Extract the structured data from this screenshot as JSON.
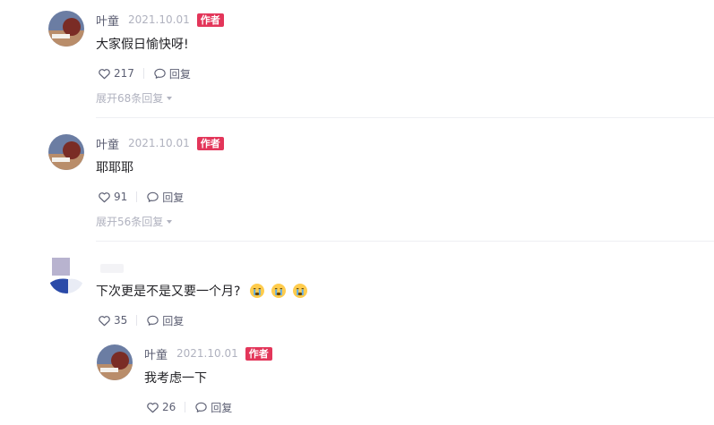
{
  "comments": [
    {
      "author": "叶童",
      "date": "2021.10.01",
      "badge": "作者",
      "text": "大家假日愉快呀!",
      "likes": "217",
      "reply_label": "回复",
      "expand_label": "展开68条回复"
    },
    {
      "author": "叶童",
      "date": "2021.10.01",
      "badge": "作者",
      "text": "耶耶耶",
      "likes": "91",
      "reply_label": "回复",
      "expand_label": "展开56条回复"
    },
    {
      "text": "下次更是不是又要一个月?",
      "likes": "35",
      "reply_label": "回复",
      "emoji": [
        "crying-emoji",
        "crying-emoji",
        "crying-emoji"
      ]
    }
  ],
  "reply": {
    "author": "叶童",
    "date": "2021.10.01",
    "badge": "作者",
    "text": "我考虑一下",
    "likes": "26",
    "reply_label": "回复"
  },
  "colors": {
    "badge": "#e3365a",
    "name": "#5c5f73",
    "date": "#b0b2bf",
    "text": "#222226"
  }
}
